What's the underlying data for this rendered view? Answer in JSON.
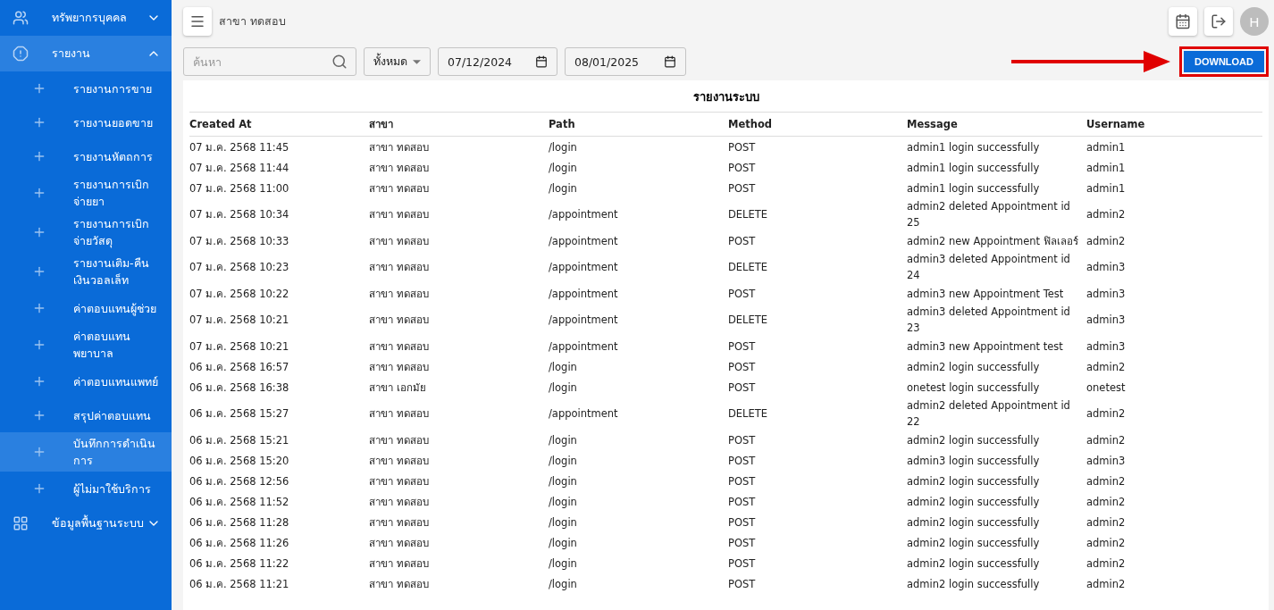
{
  "sidebar": {
    "items": [
      {
        "label": "ทรัพยากรบุคคล",
        "expanded": false,
        "selected": false
      },
      {
        "label": "รายงาน",
        "expanded": true,
        "selected": true,
        "children": [
          {
            "label": "รายงานการขาย",
            "selected": false
          },
          {
            "label": "รายงานยอดขาย",
            "selected": false
          },
          {
            "label": "รายงานหัตถการ",
            "selected": false
          },
          {
            "label": "รายงานการเบิกจ่ายยา",
            "selected": false
          },
          {
            "label": "รายงานการเบิกจ่ายวัสดุ",
            "selected": false
          },
          {
            "label": "รายงานเติม-คืนเงินวอลเล็ท",
            "selected": false
          },
          {
            "label": "ค่าตอบแทนผู้ช่วย",
            "selected": false
          },
          {
            "label": "ค่าตอบแทนพยาบาล",
            "selected": false
          },
          {
            "label": "ค่าตอบแทนแพทย์",
            "selected": false
          },
          {
            "label": "สรุปค่าตอบแทน",
            "selected": false
          },
          {
            "label": "บันทึกการดำเนินการ",
            "selected": true
          },
          {
            "label": "ผู้ไม่มาใช้บริการ",
            "selected": false
          }
        ]
      },
      {
        "label": "ข้อมูลพื้นฐานระบบ",
        "expanded": false,
        "selected": false
      }
    ]
  },
  "header": {
    "branch": "สาขา ทดสอบ",
    "avatar": "H"
  },
  "filters": {
    "search_placeholder": "ค้นหา",
    "branch_select": "ทั้งหมด",
    "date_from": "07/12/2024",
    "date_to": "08/01/2025",
    "download": "DOWNLOAD"
  },
  "table": {
    "title": "รายงานระบบ",
    "columns": [
      "Created At",
      "สาขา",
      "Path",
      "Method",
      "Message",
      "Username"
    ],
    "rows": [
      [
        "07 ม.ค. 2568 11:45",
        "สาขา ทดสอบ",
        "/login",
        "POST",
        "admin1 login successfully",
        "admin1"
      ],
      [
        "07 ม.ค. 2568 11:44",
        "สาขา ทดสอบ",
        "/login",
        "POST",
        "admin1 login successfully",
        "admin1"
      ],
      [
        "07 ม.ค. 2568 11:00",
        "สาขา ทดสอบ",
        "/login",
        "POST",
        "admin1 login successfully",
        "admin1"
      ],
      [
        "07 ม.ค. 2568 10:34",
        "สาขา ทดสอบ",
        "/appointment",
        "DELETE",
        "admin2 deleted Appointment id 25",
        "admin2"
      ],
      [
        "07 ม.ค. 2568 10:33",
        "สาขา ทดสอบ",
        "/appointment",
        "POST",
        "admin2 new Appointment ฟิลเลอร์",
        "admin2"
      ],
      [
        "07 ม.ค. 2568 10:23",
        "สาขา ทดสอบ",
        "/appointment",
        "DELETE",
        "admin3 deleted Appointment id 24",
        "admin3"
      ],
      [
        "07 ม.ค. 2568 10:22",
        "สาขา ทดสอบ",
        "/appointment",
        "POST",
        "admin3 new Appointment Test",
        "admin3"
      ],
      [
        "07 ม.ค. 2568 10:21",
        "สาขา ทดสอบ",
        "/appointment",
        "DELETE",
        "admin3 deleted Appointment id 23",
        "admin3"
      ],
      [
        "07 ม.ค. 2568 10:21",
        "สาขา ทดสอบ",
        "/appointment",
        "POST",
        "admin3 new Appointment test",
        "admin3"
      ],
      [
        "06 ม.ค. 2568 16:57",
        "สาขา ทดสอบ",
        "/login",
        "POST",
        "admin2 login successfully",
        "admin2"
      ],
      [
        "06 ม.ค. 2568 16:38",
        "สาขา เอกมัย",
        "/login",
        "POST",
        "onetest login successfully",
        "onetest"
      ],
      [
        "06 ม.ค. 2568 15:27",
        "สาขา ทดสอบ",
        "/appointment",
        "DELETE",
        "admin2 deleted Appointment id 22",
        "admin2"
      ],
      [
        "06 ม.ค. 2568 15:21",
        "สาขา ทดสอบ",
        "/login",
        "POST",
        "admin2 login successfully",
        "admin2"
      ],
      [
        "06 ม.ค. 2568 15:20",
        "สาขา ทดสอบ",
        "/login",
        "POST",
        "admin3 login successfully",
        "admin3"
      ],
      [
        "06 ม.ค. 2568 12:56",
        "สาขา ทดสอบ",
        "/login",
        "POST",
        "admin2 login successfully",
        "admin2"
      ],
      [
        "06 ม.ค. 2568 11:52",
        "สาขา ทดสอบ",
        "/login",
        "POST",
        "admin2 login successfully",
        "admin2"
      ],
      [
        "06 ม.ค. 2568 11:28",
        "สาขา ทดสอบ",
        "/login",
        "POST",
        "admin2 login successfully",
        "admin2"
      ],
      [
        "06 ม.ค. 2568 11:26",
        "สาขา ทดสอบ",
        "/login",
        "POST",
        "admin2 login successfully",
        "admin2"
      ],
      [
        "06 ม.ค. 2568 11:22",
        "สาขา ทดสอบ",
        "/login",
        "POST",
        "admin2 login successfully",
        "admin2"
      ],
      [
        "06 ม.ค. 2568 11:21",
        "สาขา ทดสอบ",
        "/login",
        "POST",
        "admin2 login successfully",
        "admin2"
      ]
    ]
  }
}
